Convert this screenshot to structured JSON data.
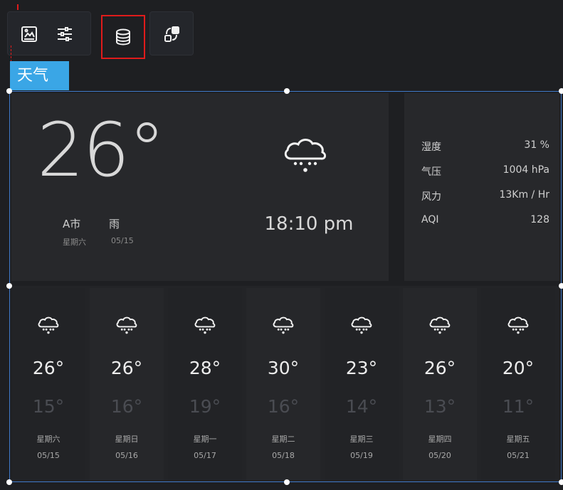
{
  "toolbar": {
    "buttons": [
      {
        "name": "image-settings",
        "icon": "image-icon"
      },
      {
        "name": "sliders",
        "icon": "sliders-icon"
      },
      {
        "name": "database",
        "icon": "database-icon",
        "active": true
      },
      {
        "name": "interaction",
        "icon": "link-shapes-icon"
      }
    ]
  },
  "widget_label": "天气",
  "current": {
    "temperature": "26°",
    "city": "A市",
    "condition": "雨",
    "weekday": "星期六",
    "date": "05/15",
    "time": "18:10 pm",
    "icon": "rain-cloud-icon"
  },
  "details": [
    {
      "label": "湿度",
      "value": "31 %"
    },
    {
      "label": "气压",
      "value": "1004 hPa"
    },
    {
      "label": "风力",
      "value": "13Km / Hr"
    },
    {
      "label": "AQI",
      "value": "128"
    }
  ],
  "forecast": [
    {
      "high": "26°",
      "low": "15°",
      "weekday": "星期六",
      "date": "05/15",
      "icon": "rain-cloud-icon"
    },
    {
      "high": "26°",
      "low": "16°",
      "weekday": "星期日",
      "date": "05/16",
      "icon": "rain-cloud-icon"
    },
    {
      "high": "28°",
      "low": "19°",
      "weekday": "星期一",
      "date": "05/17",
      "icon": "rain-cloud-icon"
    },
    {
      "high": "30°",
      "low": "16°",
      "weekday": "星期二",
      "date": "05/18",
      "icon": "rain-cloud-icon"
    },
    {
      "high": "23°",
      "low": "14°",
      "weekday": "星期三",
      "date": "05/19",
      "icon": "rain-cloud-icon"
    },
    {
      "high": "26°",
      "low": "13°",
      "weekday": "星期四",
      "date": "05/20",
      "icon": "rain-cloud-icon"
    },
    {
      "high": "20°",
      "low": "11°",
      "weekday": "星期五",
      "date": "05/21",
      "icon": "rain-cloud-icon"
    }
  ],
  "colors": {
    "accent": "#3aa6e6",
    "selection": "#3f79c9",
    "highlight": "#e01b1b"
  }
}
